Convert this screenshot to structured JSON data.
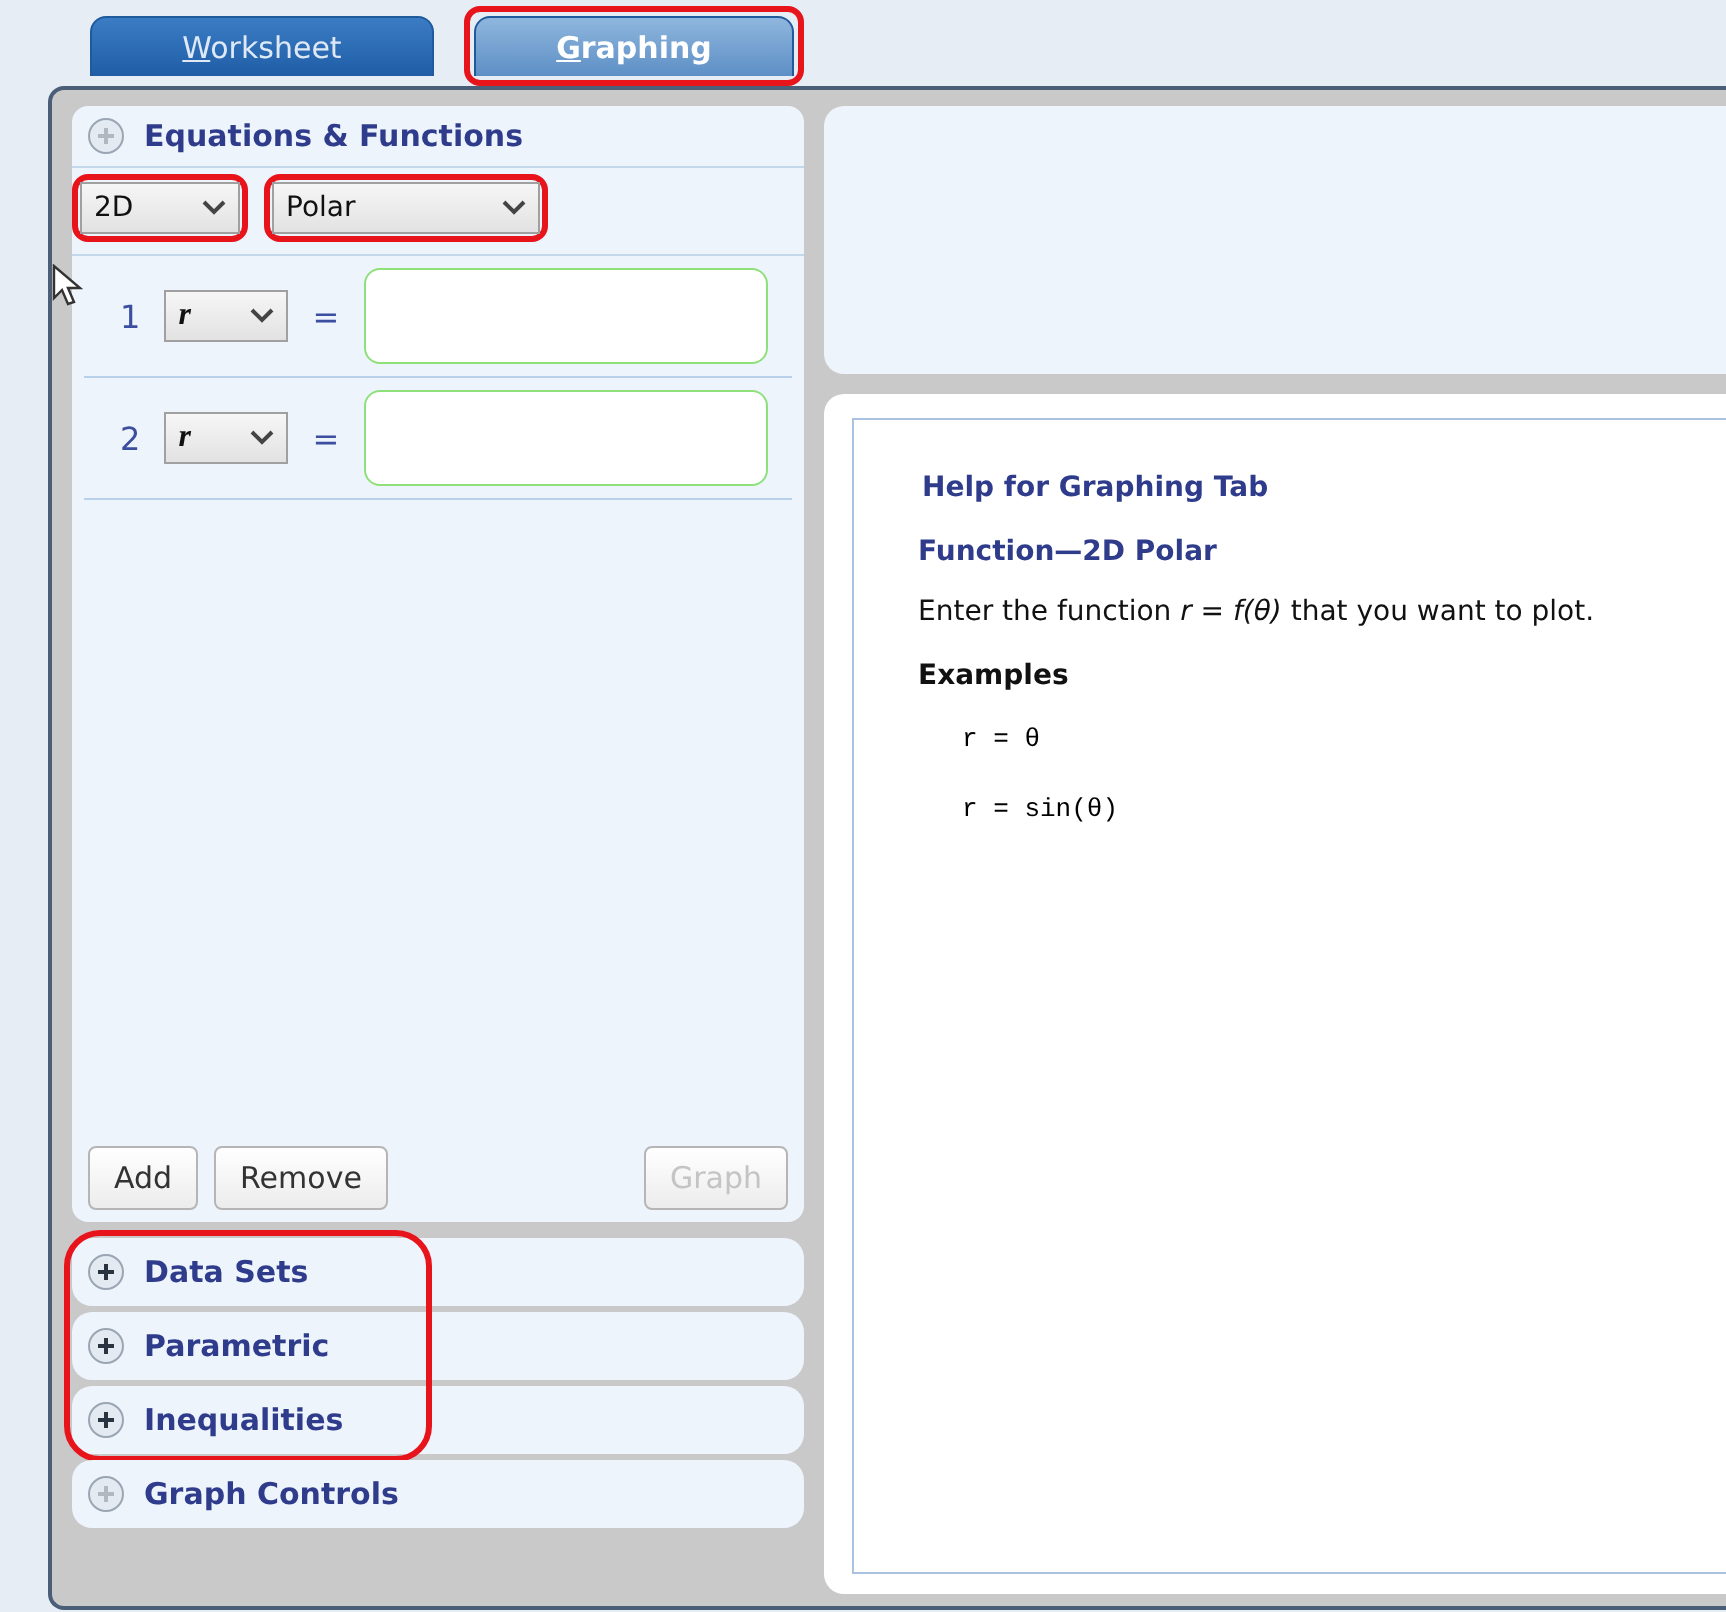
{
  "tabs": [
    {
      "label": "Worksheet",
      "selected": false,
      "annotated": false
    },
    {
      "label": "Graphing",
      "selected": true,
      "annotated": true
    }
  ],
  "equations_panel": {
    "title": "Equations & Functions",
    "expanded": true,
    "dimension": {
      "value": "2D",
      "annotated": true
    },
    "mode": {
      "value": "Polar",
      "annotated": true
    },
    "rows": [
      {
        "number": "1",
        "variable": "r",
        "operator": "="
      },
      {
        "number": "2",
        "variable": "r",
        "operator": "="
      }
    ],
    "buttons": [
      {
        "label": "Add",
        "disabled": false
      },
      {
        "label": "Remove",
        "disabled": false
      },
      {
        "label": "Graph",
        "disabled": true
      }
    ]
  },
  "sections": [
    {
      "title": "Data Sets",
      "disabled": false,
      "annotated": true
    },
    {
      "title": "Parametric",
      "disabled": false,
      "annotated": true
    },
    {
      "title": "Inequalities",
      "disabled": false,
      "annotated": true
    },
    {
      "title": "Graph Controls",
      "disabled": true,
      "annotated": false
    }
  ],
  "help": {
    "title": "Help for Graphing Tab",
    "subtitle": "Function—2D Polar",
    "text": "Enter the function *r = f(θ)* that you want to plot.",
    "examples_heading": "Examples",
    "examples": [
      "r = θ",
      "r = sin(θ)"
    ]
  }
}
